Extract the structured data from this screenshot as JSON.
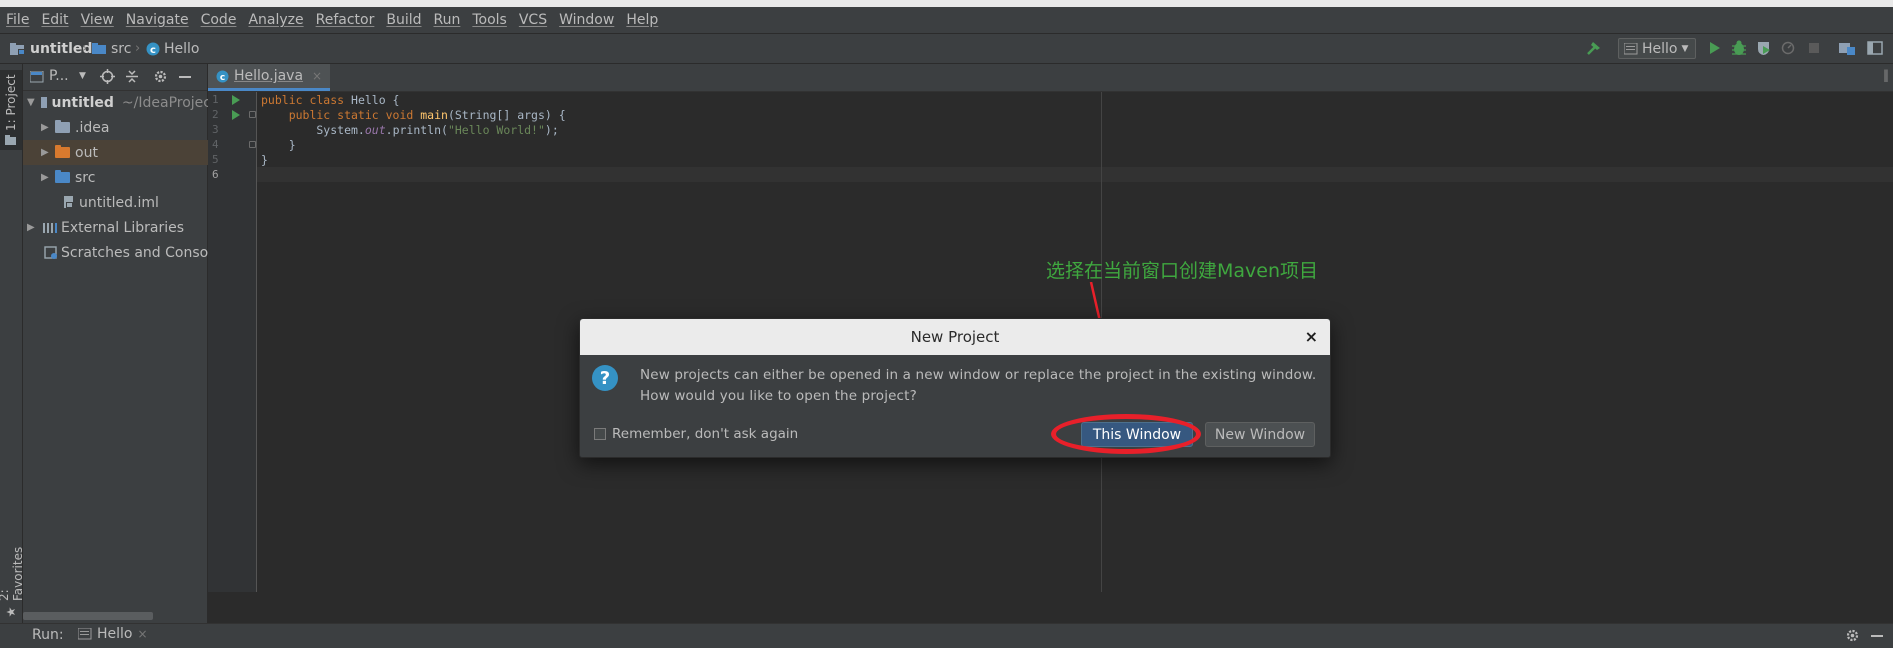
{
  "menu": [
    "File",
    "Edit",
    "View",
    "Navigate",
    "Code",
    "Analyze",
    "Refactor",
    "Build",
    "Run",
    "Tools",
    "VCS",
    "Window",
    "Help"
  ],
  "breadcrumb": {
    "project": "untitled",
    "folder": "src",
    "file": "Hello"
  },
  "toolbar": {
    "run_config": "Hello"
  },
  "left_stripe": {
    "project_tab": "1: Project",
    "favorites_tab": "2: Favorites"
  },
  "project_panel": {
    "header_label": "P...",
    "tree": [
      {
        "label": "untitled",
        "path": "~/IdeaProjec",
        "kind": "module",
        "expanded": true
      },
      {
        "label": ".idea",
        "kind": "folder"
      },
      {
        "label": "out",
        "kind": "folder-excluded",
        "selected": true
      },
      {
        "label": "src",
        "kind": "folder-source"
      },
      {
        "label": "untitled.iml",
        "kind": "file"
      },
      {
        "label": "External Libraries",
        "kind": "libraries"
      },
      {
        "label": "Scratches and Consol",
        "kind": "scratches"
      }
    ]
  },
  "editor": {
    "tab_label": "Hello.java",
    "line_numbers": [
      "1",
      "2",
      "3",
      "4",
      "5",
      "6"
    ],
    "code": {
      "l1_kw": "public class ",
      "l1_rest": "Hello {",
      "l2_kw": "    public static void ",
      "l2_fn": "main",
      "l2_rest": "(String[] args) {",
      "l3_a": "        System.",
      "l3_out": "out",
      "l3_b": ".println(",
      "l3_str": "\"Hello World!\"",
      "l3_c": ");",
      "l4": "    }",
      "l5": "}"
    }
  },
  "annotation": {
    "text": "选择在当前窗口创建Maven项目",
    "color": "#3fa83f",
    "arrow_color": "#e8202a"
  },
  "dialog": {
    "title": "New Project",
    "close": "×",
    "message_line1": "New projects can either be opened in a new window or replace the project in the existing window.",
    "message_line2": "How would you like to open the project?",
    "remember_label": "Remember, don't ask again",
    "remember_checked": false,
    "this_window_button": "This Window",
    "new_window_button": "New Window"
  },
  "run_bar": {
    "label": "Run:",
    "tab": "Hello"
  },
  "colors": {
    "accent": "#365880",
    "highlight": "#e8202a",
    "background": "#2b2b2b",
    "panel": "#3c3f41"
  }
}
